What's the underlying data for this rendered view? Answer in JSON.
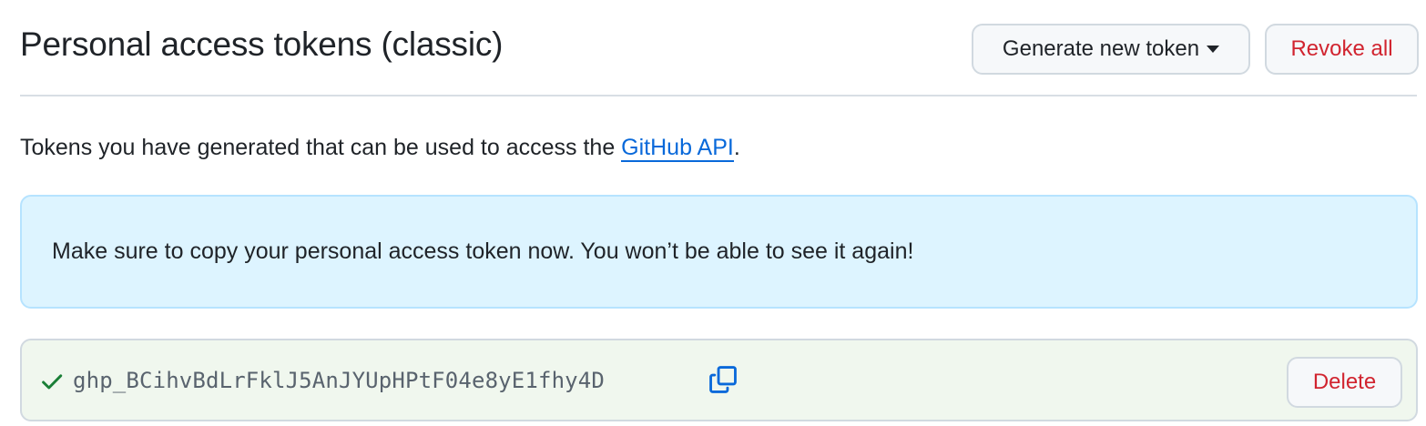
{
  "header": {
    "title": "Personal access tokens (classic)",
    "generate_label": "Generate new token",
    "revoke_label": "Revoke all"
  },
  "description": {
    "prefix": "Tokens you have generated that can be used to access the ",
    "link_text": "GitHub API",
    "suffix": "."
  },
  "flash": {
    "message": "Make sure to copy your personal access token now. You won’t be able to see it again!"
  },
  "token": {
    "value": "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",
    "delete_label": "Delete",
    "status_icon": "check-icon",
    "copy_icon": "copy-icon"
  },
  "colors": {
    "danger": "#d1242f",
    "link": "#0969da",
    "flash_bg": "#ddf4ff",
    "token_bg": "#f0f7ee",
    "success": "#1a7f37"
  }
}
